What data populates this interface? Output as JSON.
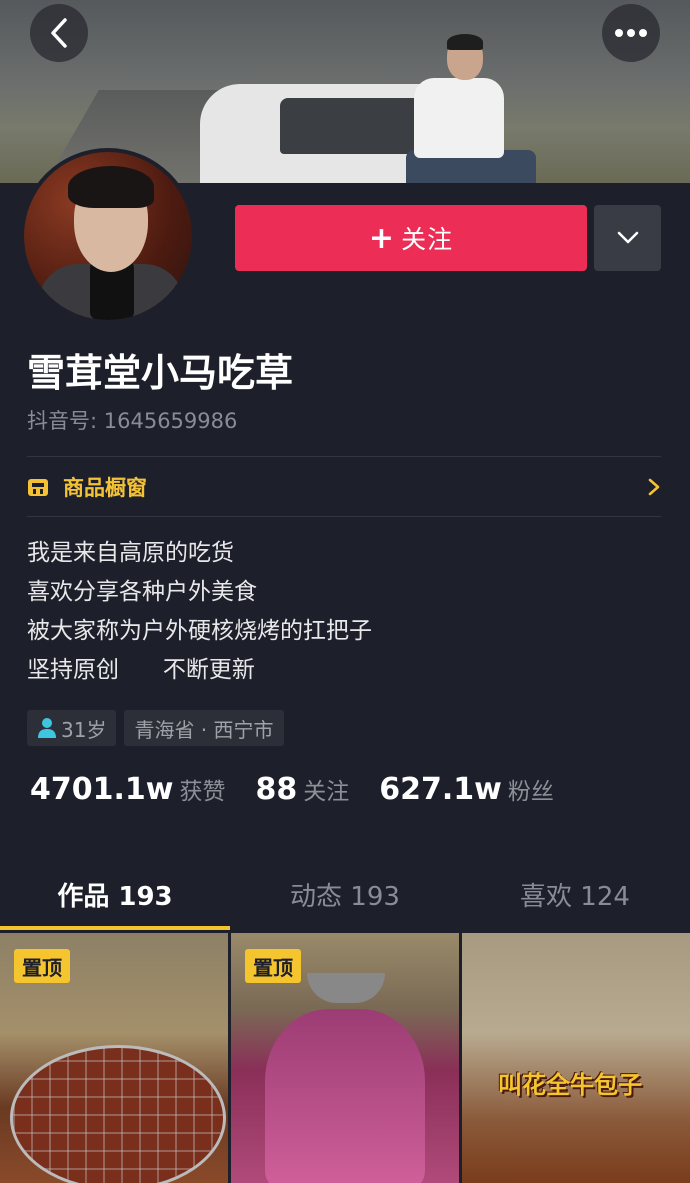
{
  "header": {
    "back_icon": "back-chevron-icon",
    "more_icon": "more-dots-icon"
  },
  "profile": {
    "follow_label": "关注",
    "name": "雪茸堂小马吃草",
    "douyin_id": "抖音号: 1645659986"
  },
  "shop": {
    "label": "商品橱窗"
  },
  "bio": [
    "我是来自高原的吃货",
    "喜欢分享各种户外美食",
    "被大家称为户外硬核烧烤的扛把子",
    "坚持原创      不断更新"
  ],
  "tags": {
    "age": "31岁",
    "location": "青海省 · 西宁市"
  },
  "stats": [
    {
      "num": "4701.1w",
      "label": "获赞"
    },
    {
      "num": "88",
      "label": "关注"
    },
    {
      "num": "627.1w",
      "label": "粉丝"
    }
  ],
  "tabs": [
    {
      "label": "作品 193"
    },
    {
      "label": "动态 193"
    },
    {
      "label": "喜欢 124"
    }
  ],
  "videos": [
    {
      "badge": "置顶"
    },
    {
      "badge": "置顶"
    },
    {
      "caption": "叫花全牛包子"
    }
  ],
  "colors": {
    "accent": "#ec2d55",
    "highlight": "#f5c52f",
    "background": "#1d1f2a"
  }
}
